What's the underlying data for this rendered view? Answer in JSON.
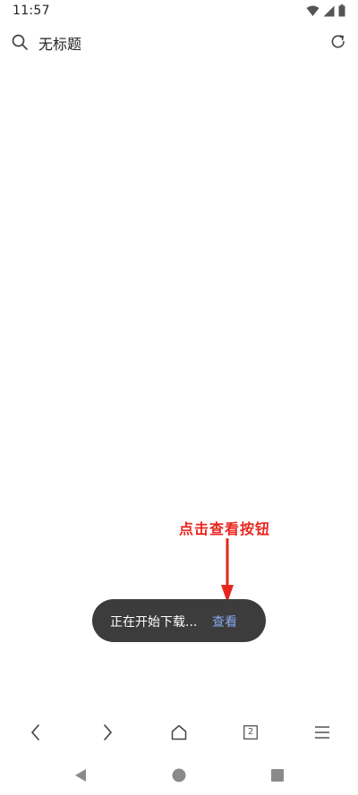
{
  "status_bar": {
    "time": "11:57",
    "icons": [
      "wifi-icon",
      "signal-icon",
      "battery-icon"
    ]
  },
  "address_bar": {
    "title": "无标题",
    "search_icon": "search-icon",
    "refresh_icon": "refresh-icon"
  },
  "annotation": {
    "text": "点击查看按钮",
    "color": "#e8261e"
  },
  "toast": {
    "message": "正在开始下载...",
    "action_label": "查看",
    "action_color": "#8aaaf2"
  },
  "toolbar": {
    "items": [
      "back-icon",
      "forward-icon",
      "home-icon",
      "tabs-icon",
      "menu-icon"
    ],
    "tab_count": "2"
  },
  "nav_bar": {
    "items": [
      "nav-back-icon",
      "nav-home-icon",
      "nav-recents-icon"
    ]
  }
}
